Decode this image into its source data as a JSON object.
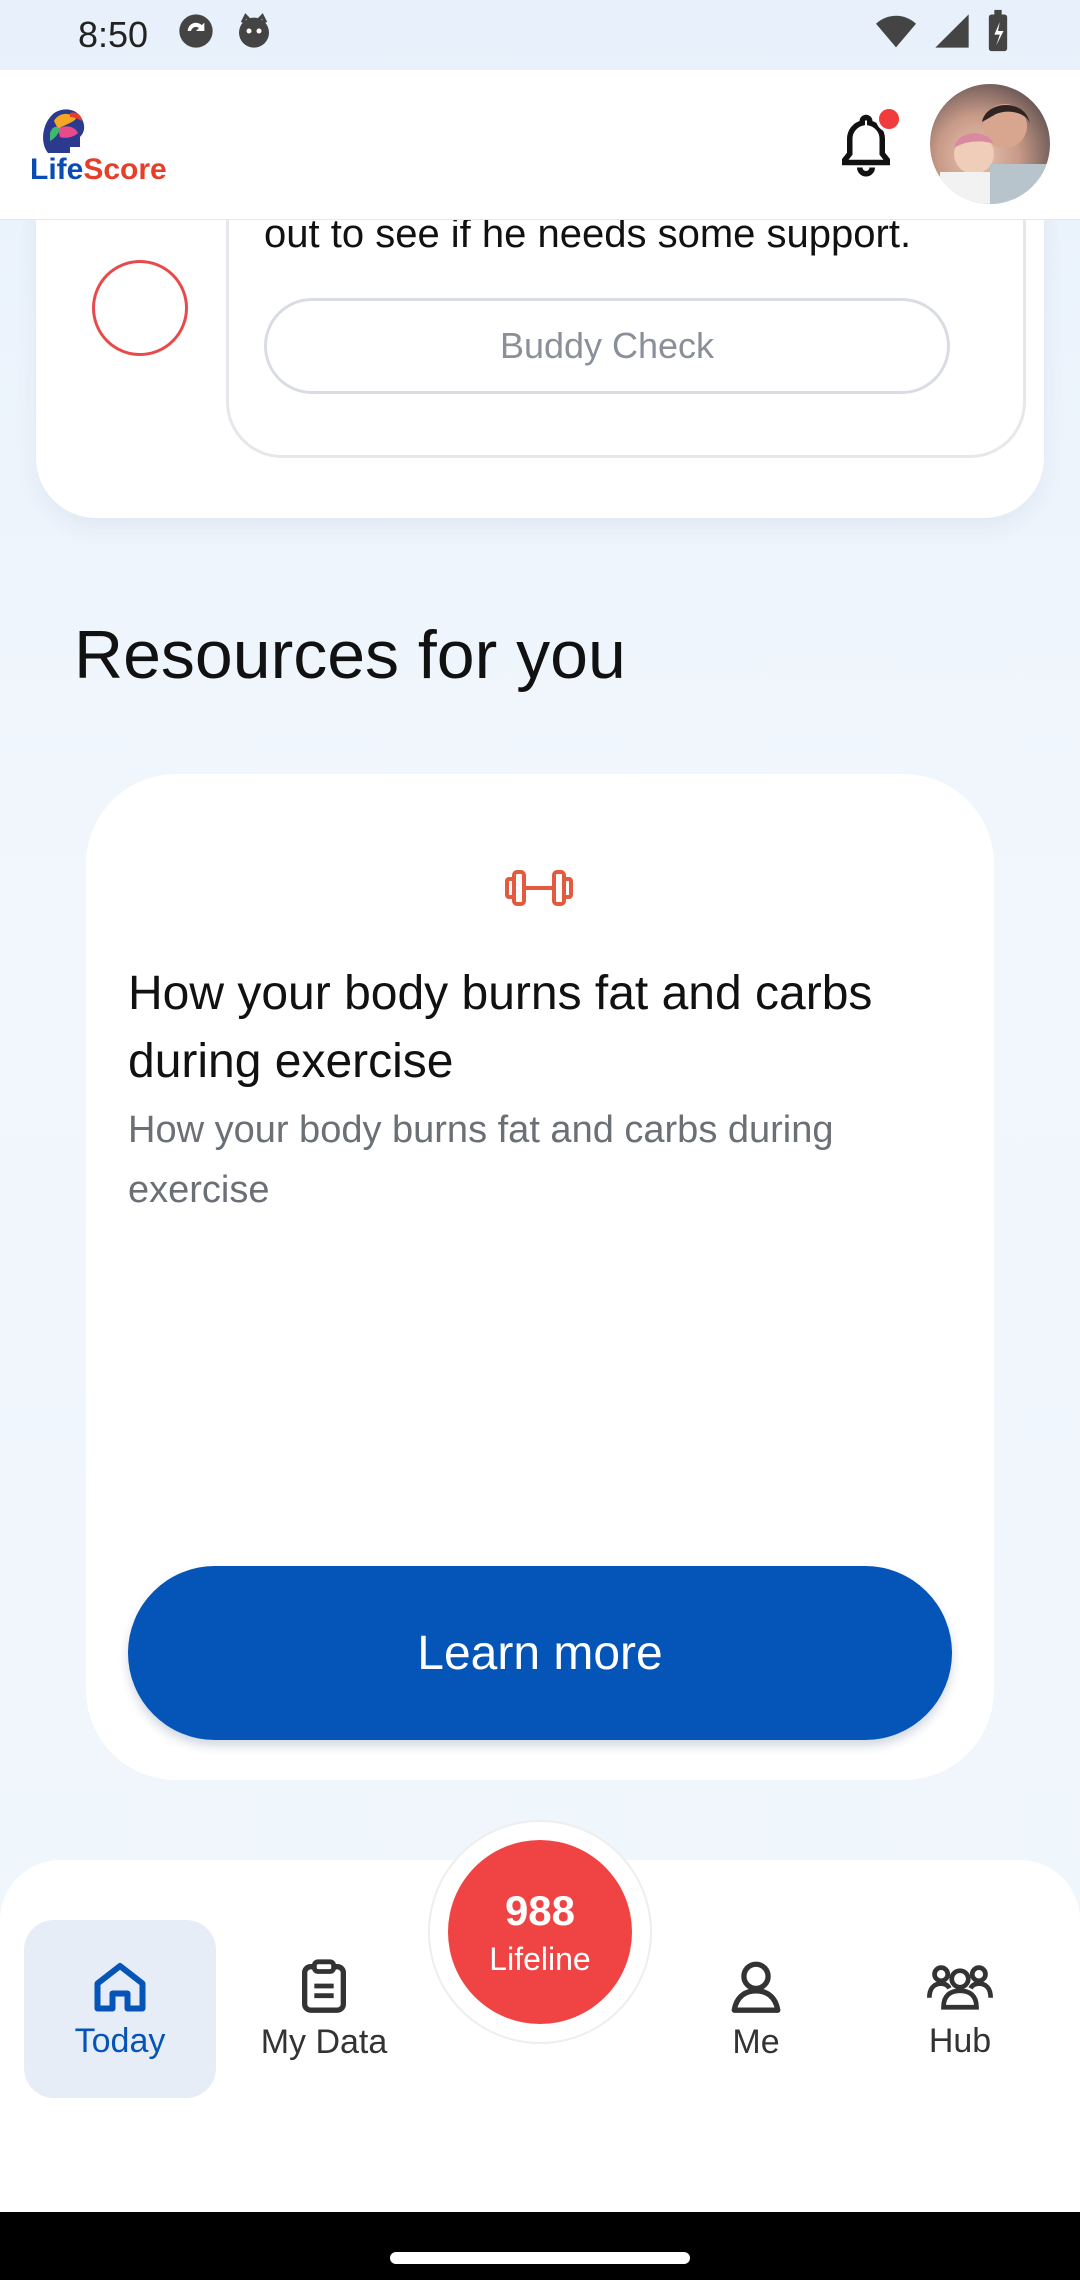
{
  "status_bar": {
    "time": "8:50"
  },
  "header": {
    "logo_life": "Life",
    "logo_score": "Score",
    "colors": {
      "brand_blue": "#0a4cb5",
      "brand_red": "#e53e2a"
    }
  },
  "top_card": {
    "text": "out to see if he needs some support.",
    "button_label": "Buddy Check"
  },
  "resources": {
    "title": "Resources for you",
    "card": {
      "icon": "dumbbell-icon",
      "title": "How your body burns fat and carbs during exercise",
      "subtitle": "How your body burns fat and carbs during exercise",
      "button_label": "Learn more"
    }
  },
  "bottom_nav": {
    "items": [
      {
        "label": "Today",
        "icon": "home-icon",
        "active": true
      },
      {
        "label": "My Data",
        "icon": "clipboard-icon",
        "active": false
      },
      {
        "label": "Me",
        "icon": "person-icon",
        "active": false
      },
      {
        "label": "Hub",
        "icon": "group-icon",
        "active": false
      }
    ],
    "lifeline": {
      "number": "988",
      "label": "Lifeline"
    }
  }
}
